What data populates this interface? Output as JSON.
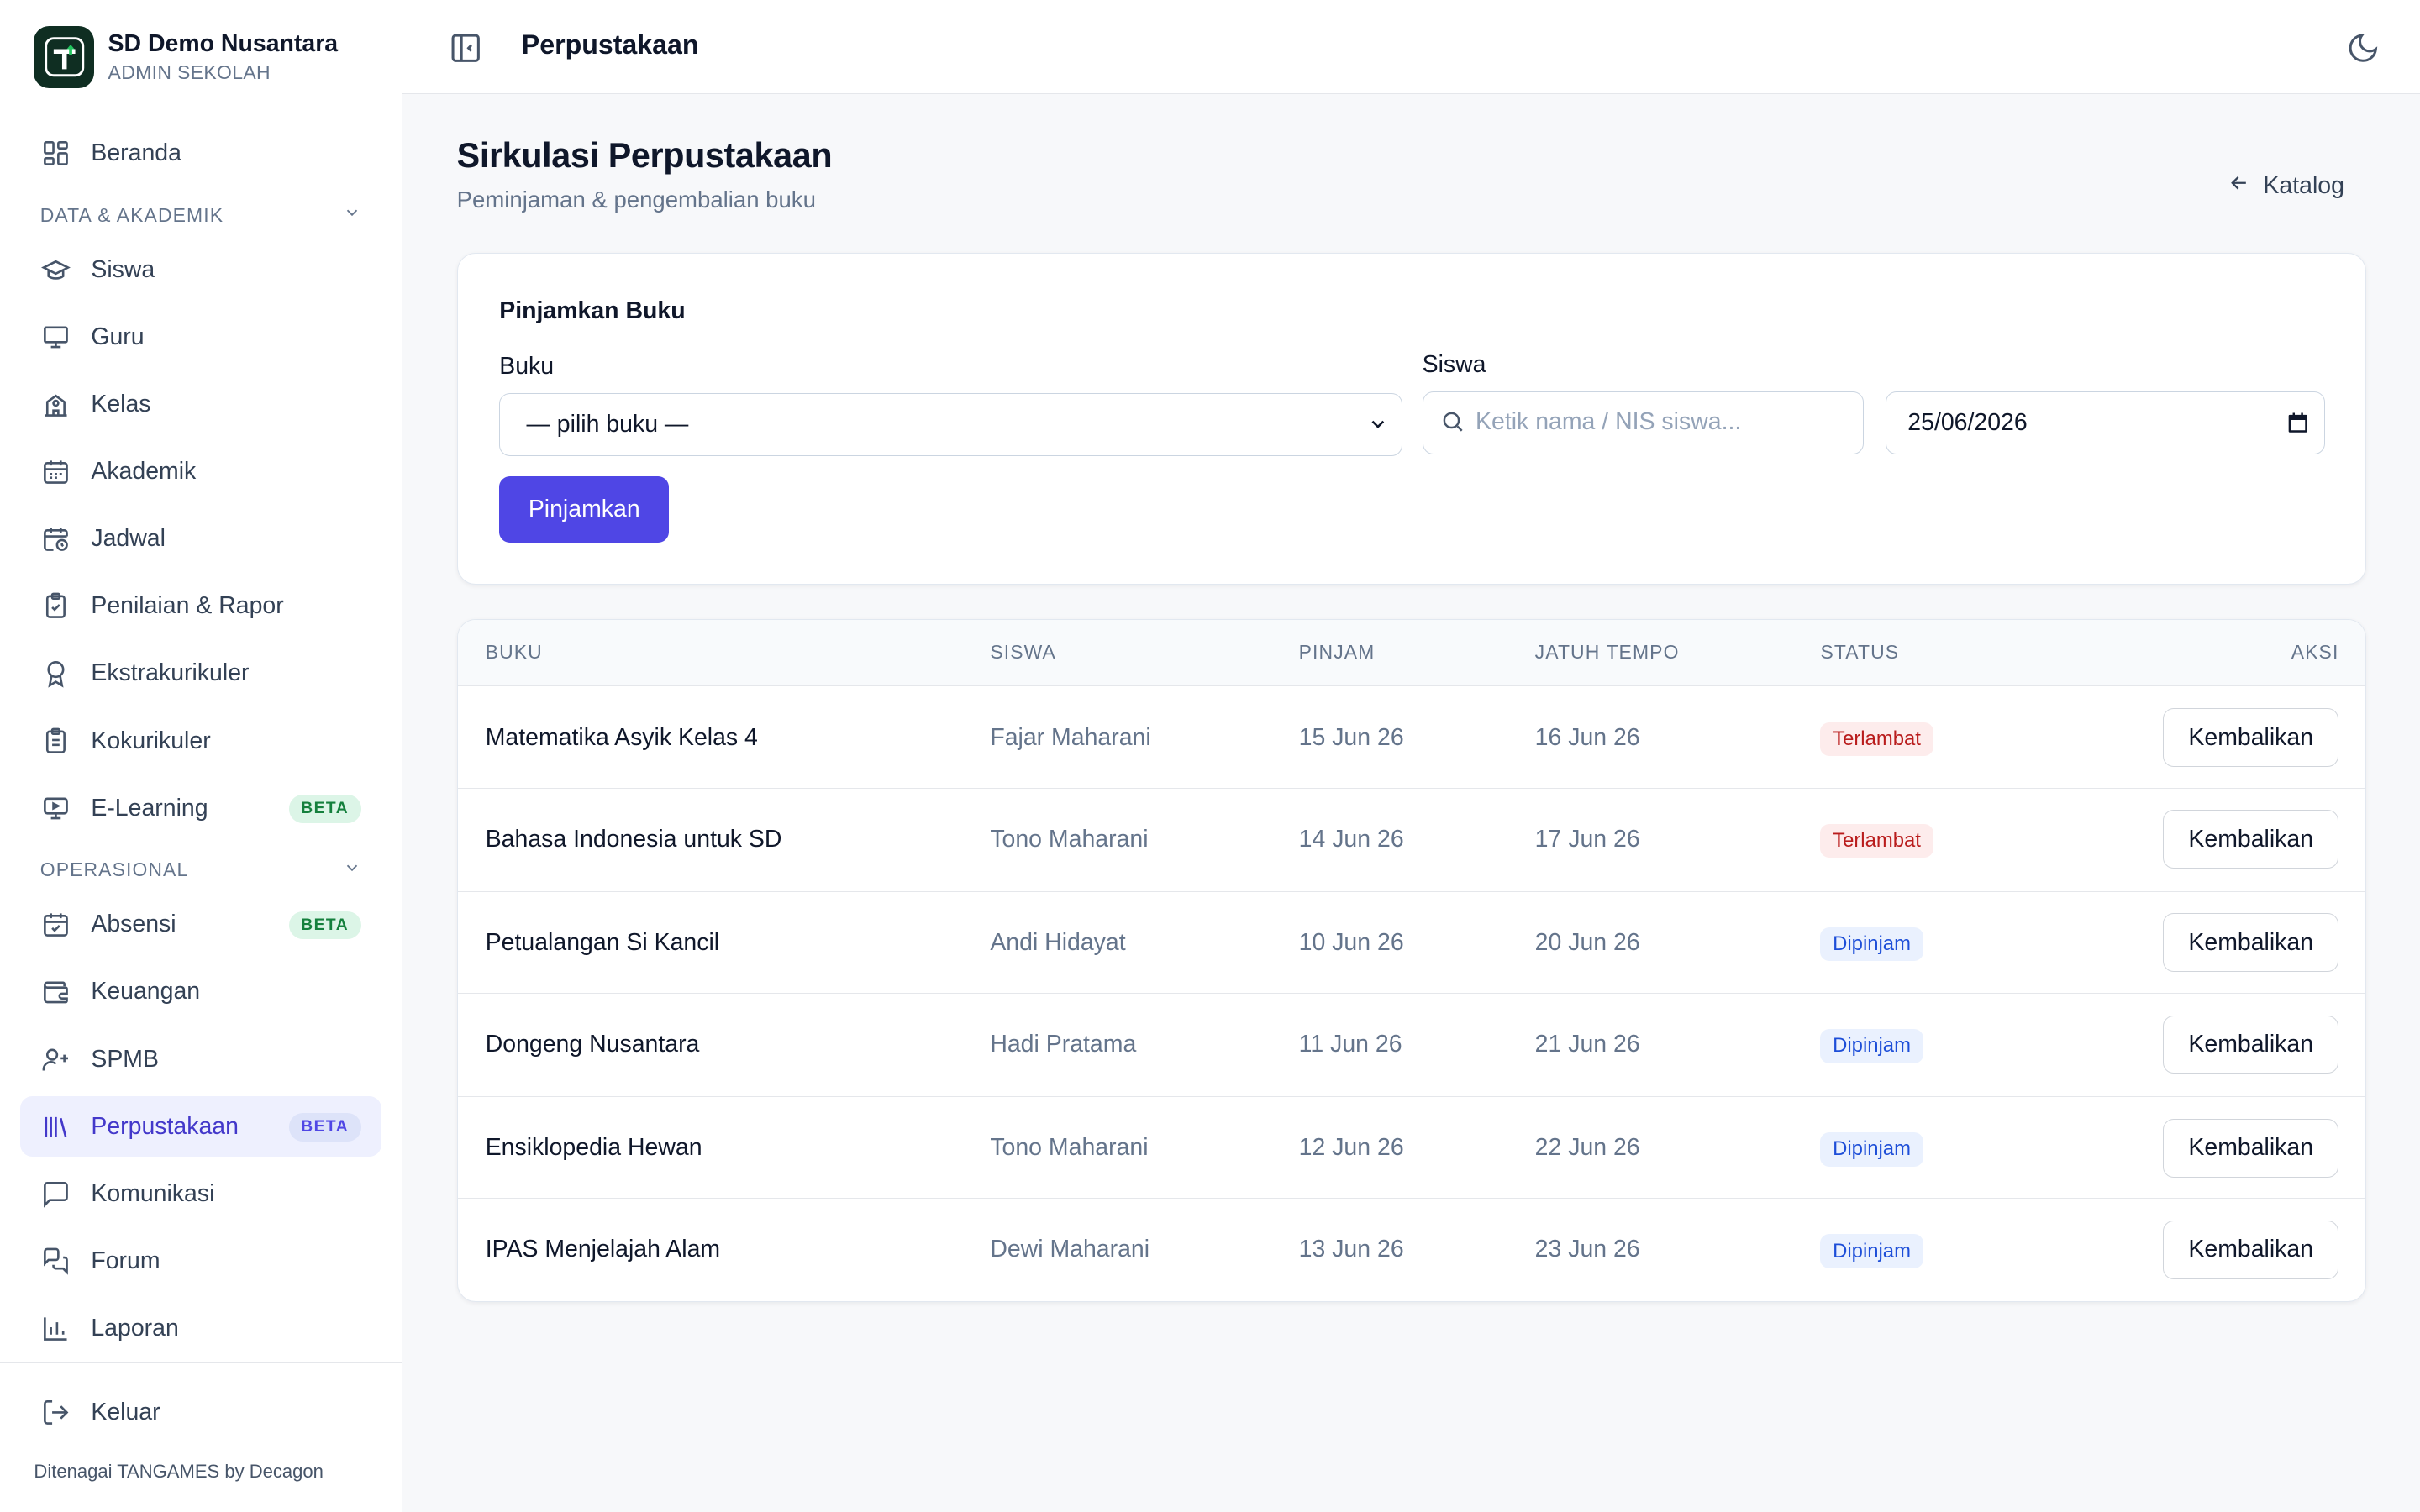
{
  "brand": {
    "name": "SD Demo Nusantara",
    "role": "ADMIN SEKOLAH"
  },
  "nav": {
    "home": "Beranda",
    "section1": "DATA & AKADEMIK",
    "siswa": "Siswa",
    "guru": "Guru",
    "kelas": "Kelas",
    "akademik": "Akademik",
    "jadwal": "Jadwal",
    "penilaian": "Penilaian & Rapor",
    "ekstra": "Ekstrakurikuler",
    "kokurikuler": "Kokurikuler",
    "elearning": "E-Learning",
    "section2": "OPERASIONAL",
    "absensi": "Absensi",
    "keuangan": "Keuangan",
    "spmb": "SPMB",
    "perpustakaan": "Perpustakaan",
    "komunikasi": "Komunikasi",
    "forum": "Forum",
    "laporan": "Laporan",
    "beta": "BETA"
  },
  "footer": {
    "logout": "Keluar",
    "powered": "Ditenagai TANGAMES by Decagon"
  },
  "header": {
    "title": "Perpustakaan"
  },
  "page": {
    "title": "Sirkulasi Perpustakaan",
    "subtitle": "Peminjaman & pengembalian buku",
    "back": "Katalog"
  },
  "form": {
    "title": "Pinjamkan Buku",
    "book_label": "Buku",
    "book_selected": "— pilih buku —",
    "student_label": "Siswa",
    "student_placeholder": "Ketik nama / NIS siswa...",
    "date": "25/06/2026",
    "submit": "Pinjamkan"
  },
  "table": {
    "headers": {
      "book": "BUKU",
      "student": "SISWA",
      "borrow": "PINJAM",
      "due": "JATUH TEMPO",
      "status": "STATUS",
      "action": "AKSI"
    },
    "action_label": "Kembalikan",
    "rows": [
      {
        "book": "Matematika Asyik Kelas 4",
        "student": "Fajar Maharani",
        "borrow": "15 Jun 26",
        "due": "16 Jun 26",
        "status": "Terlambat"
      },
      {
        "book": "Bahasa Indonesia untuk SD",
        "student": "Tono Maharani",
        "borrow": "14 Jun 26",
        "due": "17 Jun 26",
        "status": "Terlambat"
      },
      {
        "book": "Petualangan Si Kancil",
        "student": "Andi Hidayat",
        "borrow": "10 Jun 26",
        "due": "20 Jun 26",
        "status": "Dipinjam"
      },
      {
        "book": "Dongeng Nusantara",
        "student": "Hadi Pratama",
        "borrow": "11 Jun 26",
        "due": "21 Jun 26",
        "status": "Dipinjam"
      },
      {
        "book": "Ensiklopedia Hewan",
        "student": "Tono Maharani",
        "borrow": "12 Jun 26",
        "due": "22 Jun 26",
        "status": "Dipinjam"
      },
      {
        "book": "IPAS Menjelajah Alam",
        "student": "Dewi Maharani",
        "borrow": "13 Jun 26",
        "due": "23 Jun 26",
        "status": "Dipinjam"
      }
    ]
  },
  "colors": {
    "accent": "#4f46e5",
    "late": "#b91c1c",
    "borrowed": "#1d4ed8",
    "logo_bg": "#0f2e22"
  }
}
